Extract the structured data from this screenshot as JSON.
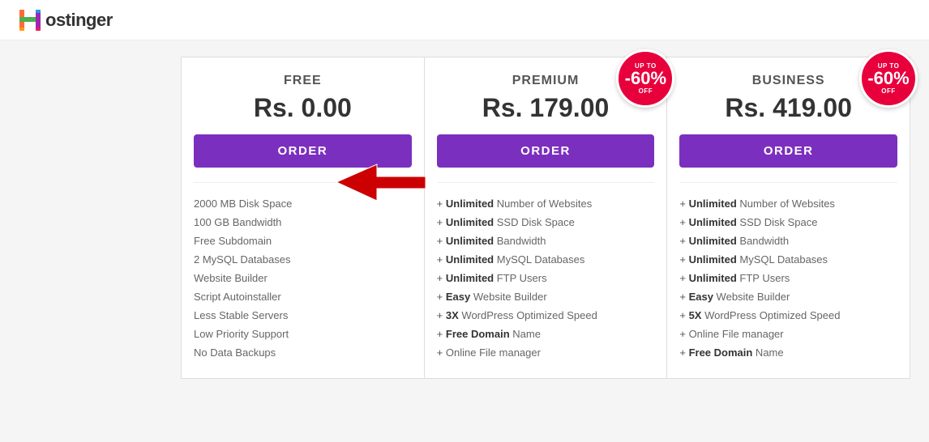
{
  "header": {
    "logo_alt": "Hostinger Logo",
    "logo_text": "ostinger"
  },
  "cards": [
    {
      "id": "free",
      "title": "FREE",
      "price": "Rs. 0.00",
      "order_label": "ORDER",
      "badge": null,
      "features": [
        {
          "bold": null,
          "text": "2000 MB Disk Space"
        },
        {
          "bold": null,
          "text": "100 GB Bandwidth"
        },
        {
          "bold": null,
          "text": "Free Subdomain"
        },
        {
          "bold": null,
          "text": "2 MySQL Databases"
        },
        {
          "bold": null,
          "text": "Website Builder"
        },
        {
          "bold": null,
          "text": "Script Autoinstaller"
        },
        {
          "bold": null,
          "text": "Less Stable Servers"
        },
        {
          "bold": null,
          "text": "Low Priority Support"
        },
        {
          "bold": null,
          "text": "No Data Backups"
        }
      ]
    },
    {
      "id": "premium",
      "title": "PREMIUM",
      "price": "Rs. 179.00",
      "order_label": "ORDER",
      "badge": {
        "up_to": "UP TO",
        "percent": "-60%",
        "off": "OFF"
      },
      "features": [
        {
          "bold": "Unlimited",
          "text": " Number of Websites"
        },
        {
          "bold": "Unlimited",
          "text": " SSD Disk Space"
        },
        {
          "bold": "Unlimited",
          "text": " Bandwidth"
        },
        {
          "bold": "Unlimited",
          "text": " MySQL Databases"
        },
        {
          "bold": "Unlimited",
          "text": " FTP Users"
        },
        {
          "bold": "Easy",
          "text": " Website Builder"
        },
        {
          "bold": "3X",
          "text": " WordPress Optimized Speed"
        },
        {
          "bold": "Free Domain",
          "text": " Name"
        },
        {
          "bold": null,
          "text": "+ Online File manager"
        }
      ]
    },
    {
      "id": "business",
      "title": "BUSINESS",
      "price": "Rs. 419.00",
      "order_label": "ORDER",
      "badge": {
        "up_to": "UP TO",
        "percent": "-60%",
        "off": "OFF"
      },
      "features": [
        {
          "bold": "Unlimited",
          "text": " Number of Websites"
        },
        {
          "bold": "Unlimited",
          "text": " SSD Disk Space"
        },
        {
          "bold": "Unlimited",
          "text": " Bandwidth"
        },
        {
          "bold": "Unlimited",
          "text": " MySQL Databases"
        },
        {
          "bold": "Unlimited",
          "text": " FTP Users"
        },
        {
          "bold": "Easy",
          "text": " Website Builder"
        },
        {
          "bold": "5X",
          "text": " WordPress Optimized Speed"
        },
        {
          "bold": null,
          "text": "+ Online File manager"
        },
        {
          "bold": "Free Domain",
          "text": " Name"
        }
      ]
    }
  ]
}
